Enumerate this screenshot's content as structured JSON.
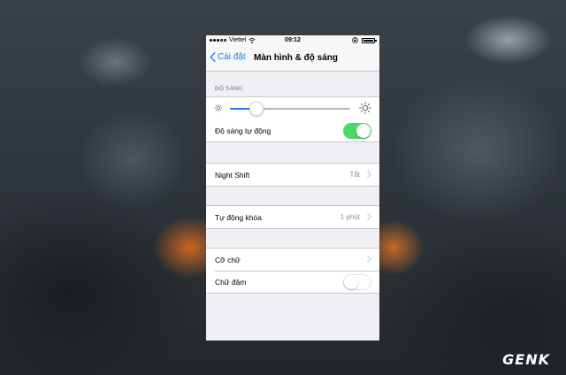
{
  "status_bar": {
    "carrier": "Viettel",
    "time": "09:12"
  },
  "nav": {
    "back_label": "Cài đặt",
    "title": "Màn hình & độ sáng"
  },
  "brightness": {
    "section_header": "ĐỘ SÁNG",
    "level": 0.22,
    "auto_label": "Độ sáng tự động",
    "auto_enabled": true
  },
  "night_shift": {
    "label": "Night Shift",
    "value": "Tắt"
  },
  "auto_lock": {
    "label": "Tự động khóa",
    "value": "1 phút"
  },
  "text": {
    "size_label": "Cỡ chữ",
    "bold_label": "Chữ đậm",
    "bold_enabled": false
  },
  "colors": {
    "accent": "#1a7cf5",
    "toggle_on": "#4cd964"
  },
  "watermark": "GENK",
  "icons": [
    "chevron-left-icon",
    "wifi-icon",
    "lock-rotation-icon",
    "battery-icon",
    "sun-small-icon",
    "sun-large-icon",
    "chevron-right-icon"
  ]
}
